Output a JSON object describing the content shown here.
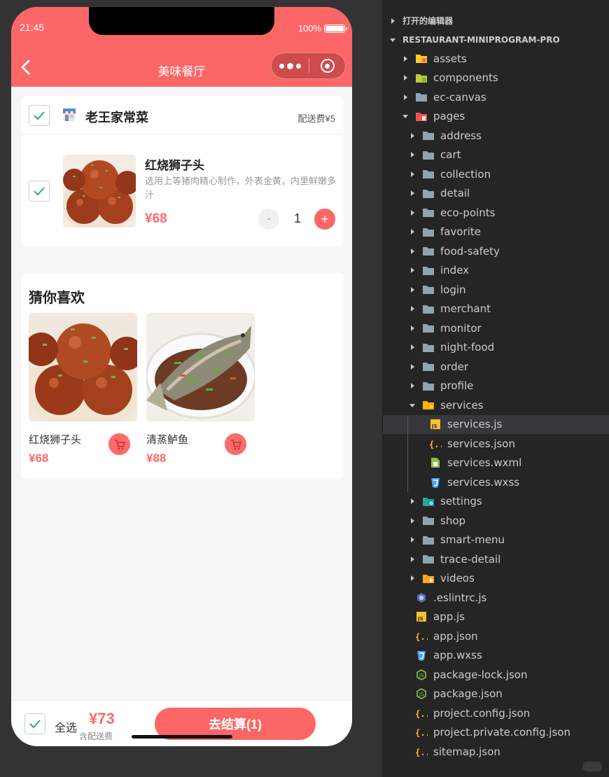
{
  "status": {
    "time": "21:45",
    "battery": "100%"
  },
  "nav": {
    "title": "美味餐厅"
  },
  "cart": {
    "shop_name": "老王家常菜",
    "delivery_fee": "配送费¥5",
    "item": {
      "name": "红烧狮子头",
      "desc": "选用上等猪肉精心制作，外表金黄，内里鲜嫩多汁",
      "price": "¥68",
      "qty": "1",
      "minus": "-",
      "plus": "+"
    }
  },
  "recommend": {
    "title": "猜你喜欢",
    "items": [
      {
        "name": "红烧狮子头",
        "price": "¥68"
      },
      {
        "name": "清蒸鲈鱼",
        "price": "¥88"
      }
    ]
  },
  "footer": {
    "select_all": "全选",
    "total": "¥73",
    "note": "含配送费",
    "checkout": "去结算(1)"
  },
  "explorer": {
    "open_editors": "打开的编辑器",
    "project": "RESTAURANT-MINIPROGRAM-PRO",
    "rows": [
      {
        "label": "assets",
        "icon": "folder-assets-icon"
      },
      {
        "label": "components",
        "icon": "folder-components-icon"
      },
      {
        "label": "ec-canvas",
        "icon": "folder-icon"
      },
      {
        "label": "pages",
        "icon": "folder-pages-icon"
      },
      {
        "label": "address",
        "icon": "folder-icon"
      },
      {
        "label": "cart",
        "icon": "folder-icon"
      },
      {
        "label": "collection",
        "icon": "folder-icon"
      },
      {
        "label": "detail",
        "icon": "folder-icon"
      },
      {
        "label": "eco-points",
        "icon": "folder-icon"
      },
      {
        "label": "favorite",
        "icon": "folder-icon"
      },
      {
        "label": "food-safety",
        "icon": "folder-icon"
      },
      {
        "label": "index",
        "icon": "folder-icon"
      },
      {
        "label": "login",
        "icon": "folder-icon"
      },
      {
        "label": "merchant",
        "icon": "folder-icon"
      },
      {
        "label": "monitor",
        "icon": "folder-icon"
      },
      {
        "label": "night-food",
        "icon": "folder-icon"
      },
      {
        "label": "order",
        "icon": "folder-icon"
      },
      {
        "label": "profile",
        "icon": "folder-icon"
      },
      {
        "label": "services",
        "icon": "folder-services-icon"
      },
      {
        "label": "services.js",
        "icon": "js-file-icon"
      },
      {
        "label": "services.json",
        "icon": "json-file-icon"
      },
      {
        "label": "services.wxml",
        "icon": "wxml-file-icon"
      },
      {
        "label": "services.wxss",
        "icon": "wxss-file-icon"
      },
      {
        "label": "settings",
        "icon": "folder-settings-icon"
      },
      {
        "label": "shop",
        "icon": "folder-icon"
      },
      {
        "label": "smart-menu",
        "icon": "folder-icon"
      },
      {
        "label": "trace-detail",
        "icon": "folder-icon"
      },
      {
        "label": "videos",
        "icon": "folder-videos-icon"
      },
      {
        "label": ".eslintrc.js",
        "icon": "eslint-file-icon"
      },
      {
        "label": "app.js",
        "icon": "js-file-icon"
      },
      {
        "label": "app.json",
        "icon": "json-file-icon"
      },
      {
        "label": "app.wxss",
        "icon": "wxss-file-icon"
      },
      {
        "label": "package-lock.json",
        "icon": "node-file-icon"
      },
      {
        "label": "package.json",
        "icon": "node-file-icon"
      },
      {
        "label": "project.config.json",
        "icon": "json-file-icon"
      },
      {
        "label": "project.private.config.json",
        "icon": "json-file-icon"
      },
      {
        "label": "sitemap.json",
        "icon": "json-file-icon"
      }
    ]
  },
  "colors": {
    "brand": "#fc6666",
    "price": "#fc6b6b",
    "check": "#2fb35a",
    "explorer_bg": "#252526"
  }
}
